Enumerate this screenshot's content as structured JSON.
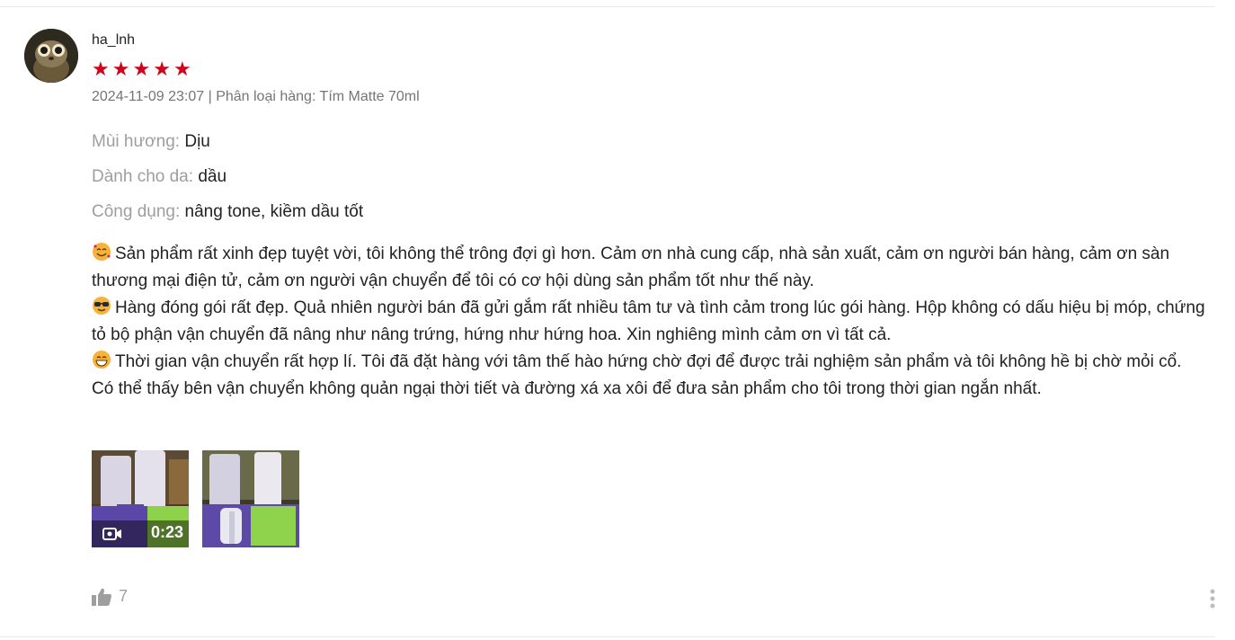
{
  "review": {
    "username": "ha_lnh",
    "rating": 5,
    "meta": "2024-11-09 23:07 | Phân loại hàng: Tím Matte 70ml",
    "attributes": [
      {
        "key": "Mùi hương:",
        "value": "Dịu"
      },
      {
        "key": "Dành cho da:",
        "value": "dầu"
      },
      {
        "key": "Công dụng:",
        "value": "nâng tone, kiềm dầu tốt"
      }
    ],
    "paragraphs": [
      {
        "emoji": "smiling-face-with-hearts-icon",
        "text": "Sản phẩm rất xinh đẹp tuyệt vời, tôi không thể trông đợi gì hơn. Cảm ơn nhà cung cấp, nhà sản xuất, cảm ơn người bán hàng, cảm ơn sàn thương mại điện tử, cảm ơn người vận chuyển để tôi có cơ hội dùng sản phẩm tốt như thế này."
      },
      {
        "emoji": "sunglasses-face-icon",
        "text": "Hàng đóng gói rất đẹp. Quả nhiên người bán đã gửi gắm rất nhiều tâm tư và tình cảm trong lúc gói hàng. Hộp không có dấu hiệu bị móp, chứng tỏ bộ phận vận chuyển đã nâng như nâng trứng, hứng như hứng hoa. Xin nghiêng mình cảm ơn vì tất cả."
      },
      {
        "emoji": "grinning-face-icon",
        "text": "Thời gian vận chuyển rất hợp lí. Tôi đã đặt hàng với tâm thế hào hứng chờ đợi để được trải nghiệm sản phẩm và tôi không hề bị chờ mỏi cổ. Có thể thấy bên vận chuyển không quản ngại thời tiết và đường xá xa xôi để đưa sản phẩm cho tôi trong thời gian ngắn nhất."
      }
    ],
    "media": {
      "video_duration": "0:23"
    },
    "likes": "7",
    "colors": {
      "star": "#d0011b",
      "muted": "#9e9e9e",
      "meta": "#757575"
    }
  }
}
